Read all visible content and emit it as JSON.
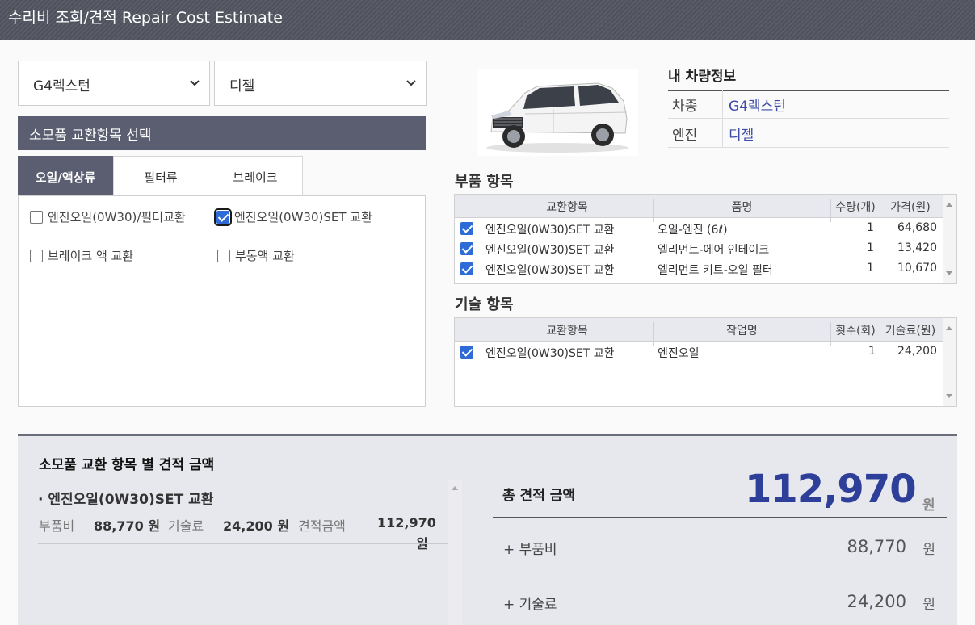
{
  "header": {
    "title": "수리비 조회/견적 Repair Cost Estimate"
  },
  "selects": {
    "model": "G4렉스턴",
    "engine": "디젤"
  },
  "consumables": {
    "title": "소모품 교환항목 선택",
    "tabs": [
      "오일/액상류",
      "필터류",
      "브레이크"
    ],
    "active_tab": "오일/액상류",
    "items": [
      {
        "label": "엔진오일(0W30)/필터교환",
        "checked": false
      },
      {
        "label": "엔진오일(0W30)SET 교환",
        "checked": true
      },
      {
        "label": "브레이크 액 교환",
        "checked": false
      },
      {
        "label": "부동액 교환",
        "checked": false
      }
    ]
  },
  "vehicle_info": {
    "title": "내 차량정보",
    "rows": [
      {
        "key": "차종",
        "value": "G4렉스턴"
      },
      {
        "key": "엔진",
        "value": "디젤"
      }
    ]
  },
  "parts": {
    "title": "부품 항목",
    "headers": [
      "교환항목",
      "품명",
      "수량(개)",
      "가격(원)"
    ],
    "rows": [
      {
        "checked": true,
        "item": "엔진오일(0W30)SET 교환",
        "name": "오일-엔진 (6ℓ)",
        "qty": "1",
        "price": "64,680"
      },
      {
        "checked": true,
        "item": "엔진오일(0W30)SET 교환",
        "name": "엘리먼트-에어 인테이크",
        "qty": "1",
        "price": "13,420"
      },
      {
        "checked": true,
        "item": "엔진오일(0W30)SET 교환",
        "name": "엘리먼트 키트-오일 필터",
        "qty": "1",
        "price": "10,670"
      }
    ]
  },
  "labor": {
    "title": "기술 항목",
    "headers": [
      "교환항목",
      "작업명",
      "횟수(회)",
      "기술료(원)"
    ],
    "rows": [
      {
        "checked": true,
        "item": "엔진오일(0W30)SET 교환",
        "name": "엔진오일",
        "qty": "1",
        "price": "24,200"
      }
    ]
  },
  "summary": {
    "title": "소모품 교환 항목 별 견적 금액",
    "item_title": "· 엔진오일(0W30)SET 교환",
    "parts_label": "부품비",
    "parts_value": "88,770 원",
    "labor_label": "기술료",
    "labor_value": "24,200 원",
    "estimate_label": "견적금액",
    "estimate_value": "112,970",
    "estimate_unit": "원"
  },
  "total": {
    "label": "총 견적 금액",
    "value": "112,970",
    "unit": "원",
    "breakdown": [
      {
        "label": "+ 부품비",
        "value": "88,770",
        "unit": "원"
      },
      {
        "label": "+ 기술료",
        "value": "24,200",
        "unit": "원"
      }
    ]
  },
  "colors": {
    "header_bg": "#5a5e70",
    "accent_blue": "#2e3f9a",
    "checkbox_blue": "#2f6bd6"
  }
}
